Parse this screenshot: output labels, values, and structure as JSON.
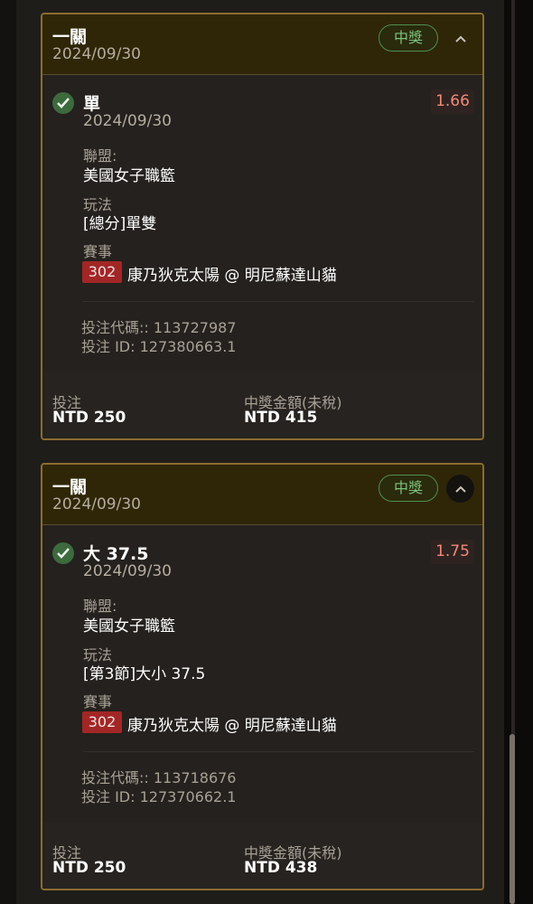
{
  "bets": [
    {
      "leg_title": "一關",
      "leg_date": "2024/09/30",
      "status_badge": "中獎",
      "selection": "單",
      "selection_date": "2024/09/30",
      "odds": "1.66",
      "league_label": "聯盟:",
      "league": "美國女子職籃",
      "market_label": "玩法",
      "market": "[總分]單雙",
      "event_label": "賽事",
      "event_number": "302",
      "event_name": "康乃狄克太陽 @ 明尼蘇達山貓",
      "bet_code": "投注代碼:: 113727987",
      "bet_id": "投注 ID: 127380663.1",
      "stake_label": "投注",
      "stake": "NTD 250",
      "payout_label": "中獎金額(未稅)",
      "payout": "NTD 415"
    },
    {
      "leg_title": "一關",
      "leg_date": "2024/09/30",
      "status_badge": "中獎",
      "selection": "大 37.5",
      "selection_date": "2024/09/30",
      "odds": "1.75",
      "league_label": "聯盟:",
      "league": "美國女子職籃",
      "market_label": "玩法",
      "market": "[第3節]大小 37.5",
      "event_label": "賽事",
      "event_number": "302",
      "event_name": "康乃狄克太陽 @ 明尼蘇達山貓",
      "bet_code": "投注代碼:: 113718676",
      "bet_id": "投注 ID: 127370662.1",
      "stake_label": "投注",
      "stake": "NTD 250",
      "payout_label": "中獎金額(未稅)",
      "payout": "NTD 438"
    }
  ],
  "icons": {
    "check": "check-circle-icon",
    "collapse": "chevron-up-icon"
  },
  "colors": {
    "card_border": "#8a6d2f",
    "win_green": "#7cc27c",
    "odds_red": "#f08a7a",
    "event_badge": "#a32626"
  }
}
